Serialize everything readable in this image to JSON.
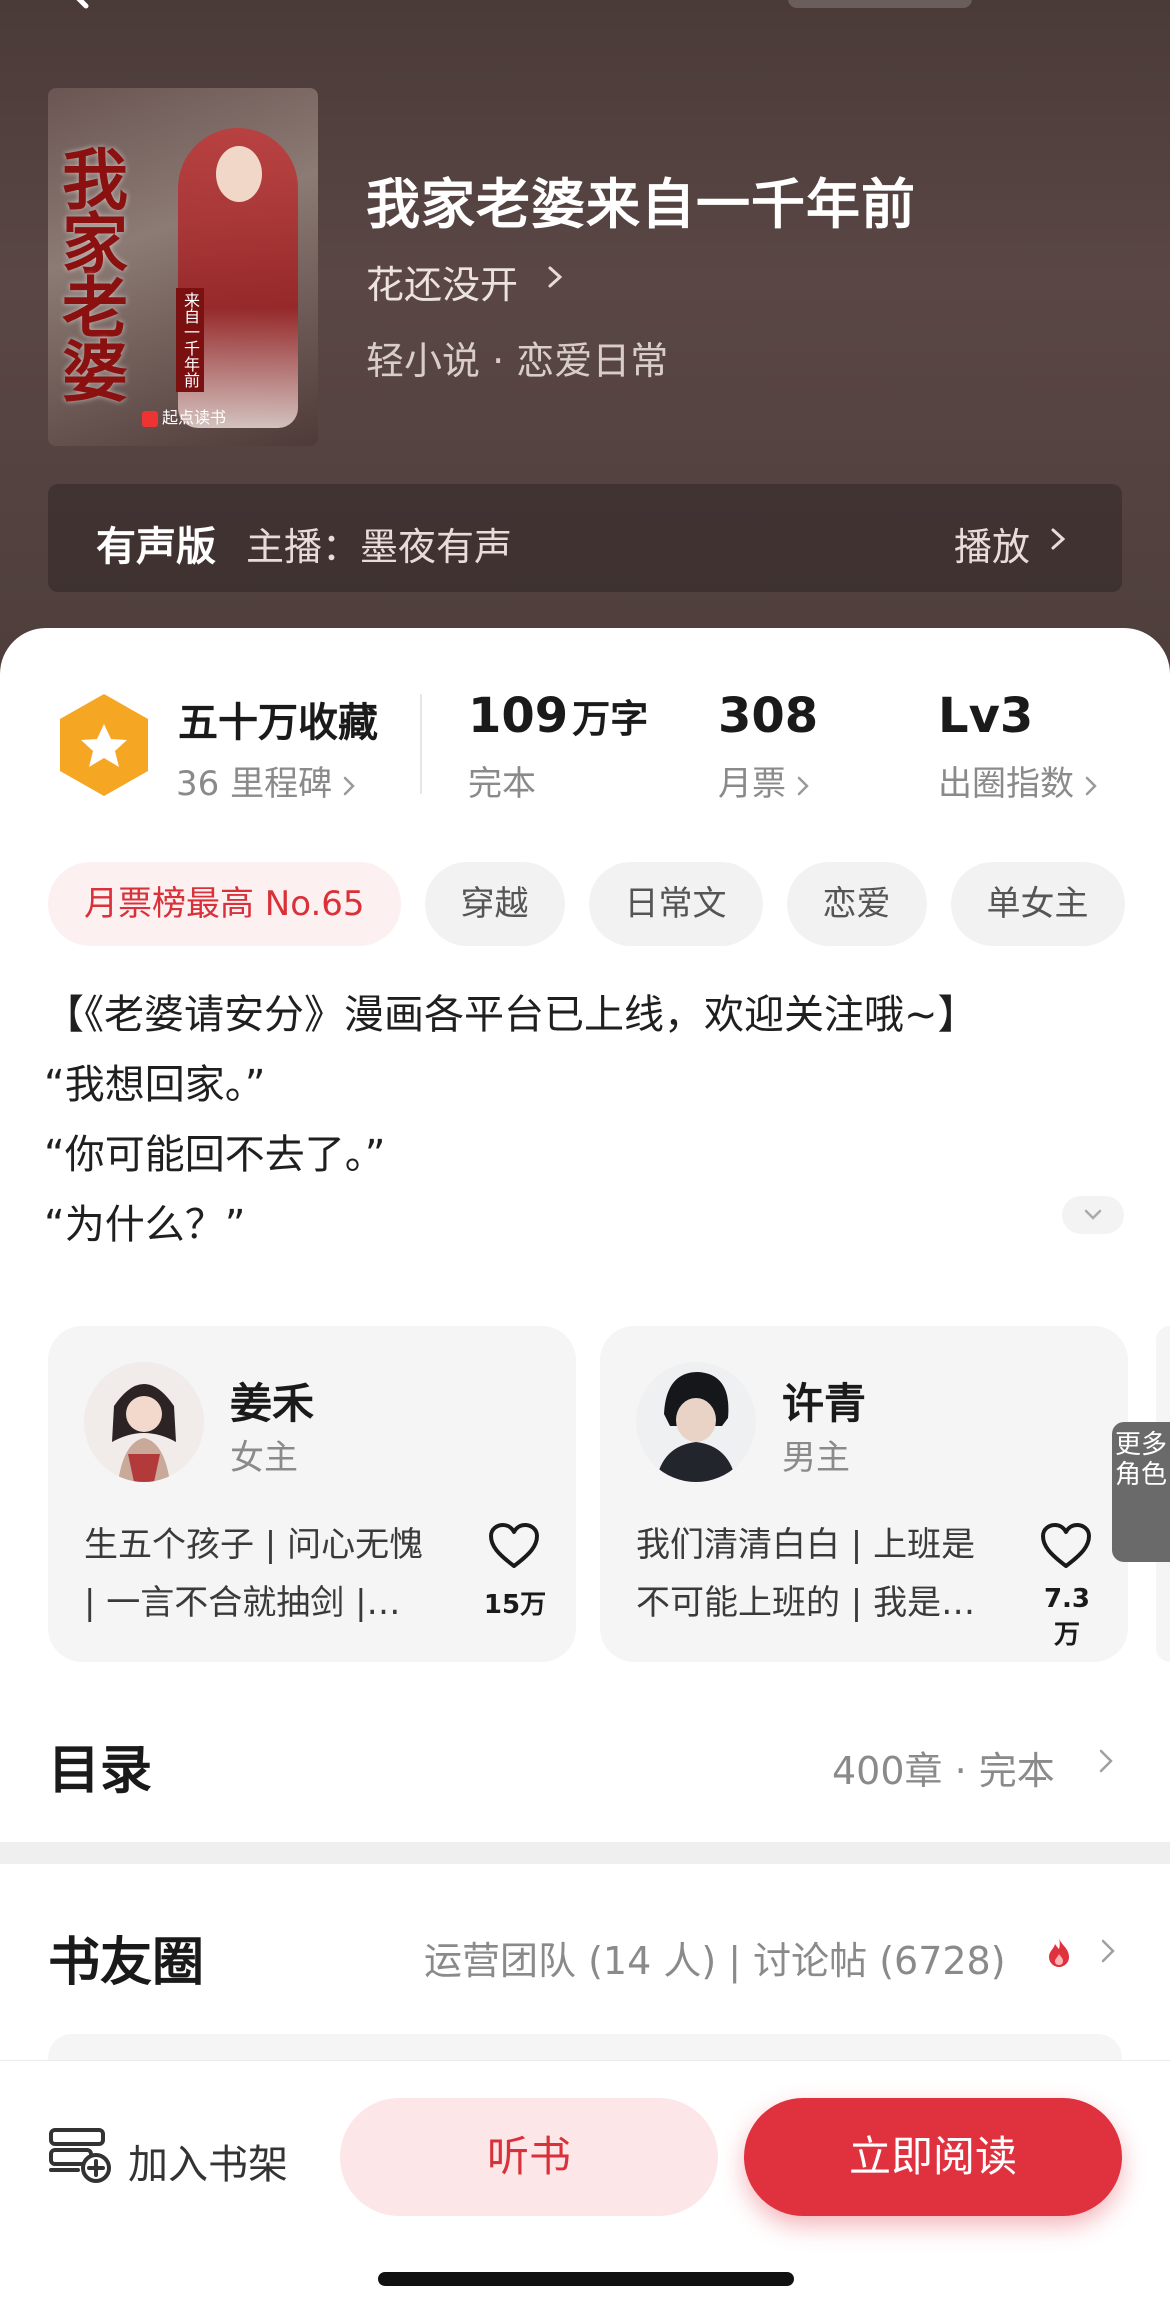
{
  "book": {
    "title": "我家老婆来自一千年前",
    "author": "花还没开",
    "genre": "轻小说 · 恋爱日常",
    "cover": {
      "title_text": "我家老婆",
      "subtitle_text": "来自一千年前",
      "brand": "起点读书"
    }
  },
  "audio": {
    "label": "有声版",
    "host": "主播：墨夜有声",
    "play_label": "播放"
  },
  "stats": {
    "collect": "五十万收藏",
    "milestone": "36 里程碑",
    "words_num": "109",
    "words_unit": "万字",
    "words_sub": "完本",
    "tickets_num": "308",
    "tickets_sub": "月票",
    "level_num": "Lv3",
    "level_sub": "出圈指数"
  },
  "tags": [
    "月票榜最高 No.65",
    "穿越",
    "日常文",
    "恋爱",
    "单女主"
  ],
  "synopsis": {
    "line1": "【《老婆请安分》漫画各平台已上线，欢迎关注哦~】",
    "line2": "“我想回家。”",
    "line3": "“你可能回不去了。”",
    "line4": "“为什么？”"
  },
  "characters": [
    {
      "name": "姜禾",
      "role": "女主",
      "desc": "生五个孩子 | 问心无愧 | 一言不合就抽剑 |…",
      "likes": "15万"
    },
    {
      "name": "许青",
      "role": "男主",
      "desc": "我们清清白白 | 上班是不可能上班的 | 我是…",
      "likes": "7.3万"
    }
  ],
  "more_roles_label": "更多角色",
  "toc": {
    "title": "目录",
    "meta": "400章 · 完本"
  },
  "club": {
    "title": "书友圈",
    "meta": "运营团队 (14 人) | 讨论帖 (6728)"
  },
  "bottom": {
    "shelf_label": "加入书架",
    "listen_label": "听书",
    "read_label": "立即阅读"
  },
  "colors": {
    "accent": "#e0313f",
    "hero_bg": "#4a3a38",
    "hot_tag_text": "#d9313a",
    "badge": "#f5a623"
  },
  "icons": [
    "back-icon",
    "chevron-right-icon",
    "star-badge-icon",
    "heart-icon",
    "fire-icon",
    "add-to-shelf-icon",
    "chevron-down-icon"
  ]
}
